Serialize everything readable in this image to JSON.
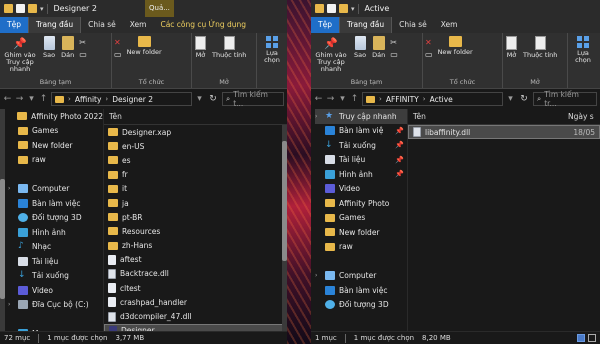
{
  "left": {
    "window_title": "Designer 2",
    "context_tab": "Quả...",
    "menu": {
      "file": "Tệp",
      "home": "Trang đầu",
      "share": "Chia sẻ",
      "view": "Xem",
      "context": "Các công cụ Ứng dụng"
    },
    "ribbon": {
      "pin": "Ghim vào Truy cập nhanh",
      "copy": "Sao",
      "paste": "Dán",
      "move": "New folder",
      "open": "Mở",
      "props": "Thuộc tính",
      "select": "Lựa chọn",
      "group_clipboard": "Bảng tạm",
      "group_organize": "Tổ chức",
      "group_open": "Mở"
    },
    "path": [
      "Affinity",
      "Designer 2"
    ],
    "search_placeholder": "Tìm kiếm t...",
    "nav_items": [
      {
        "label": "Affinity Photo 2022",
        "icon": "folder-icon"
      },
      {
        "label": "Games",
        "icon": "folder-icon"
      },
      {
        "label": "New folder",
        "icon": "folder-icon"
      },
      {
        "label": "raw",
        "icon": "folder-icon"
      },
      {
        "label": "",
        "icon": "spacer"
      },
      {
        "label": "Computer",
        "icon": "computer-icon"
      },
      {
        "label": "Bàn làm việc",
        "icon": "desktop-icon"
      },
      {
        "label": "Đối tượng 3D",
        "icon": "3d-objects-icon"
      },
      {
        "label": "Hình ảnh",
        "icon": "pictures-icon"
      },
      {
        "label": "Nhạc",
        "icon": "music-icon"
      },
      {
        "label": "Tài liệu",
        "icon": "documents-icon"
      },
      {
        "label": "Tải xuống",
        "icon": "downloads-icon"
      },
      {
        "label": "Video",
        "icon": "videos-icon"
      },
      {
        "label": "Đĩa Cục bộ (C:)",
        "icon": "drive-icon"
      },
      {
        "label": "",
        "icon": "spacer"
      },
      {
        "label": "Mạng",
        "icon": "network-icon"
      }
    ],
    "column_name": "Tên",
    "files": [
      {
        "name": "Designer.xap",
        "type": "folder"
      },
      {
        "name": "en-US",
        "type": "folder"
      },
      {
        "name": "es",
        "type": "folder"
      },
      {
        "name": "fr",
        "type": "folder"
      },
      {
        "name": "it",
        "type": "folder"
      },
      {
        "name": "ja",
        "type": "folder"
      },
      {
        "name": "pt-BR",
        "type": "folder"
      },
      {
        "name": "Resources",
        "type": "folder"
      },
      {
        "name": "zh-Hans",
        "type": "folder"
      },
      {
        "name": "aftest",
        "type": "file"
      },
      {
        "name": "Backtrace.dll",
        "type": "dll"
      },
      {
        "name": "cltest",
        "type": "file"
      },
      {
        "name": "crashpad_handler",
        "type": "file"
      },
      {
        "name": "d3dcompiler_47.dll",
        "type": "dll"
      },
      {
        "name": "Designer",
        "type": "exe",
        "selected": true
      }
    ],
    "status": {
      "count": "72 mục",
      "selected": "1 mục được chọn",
      "size": "3,77 MB"
    }
  },
  "right": {
    "window_title": "Active",
    "menu": {
      "file": "Tệp",
      "home": "Trang đầu",
      "share": "Chia sẻ",
      "view": "Xem"
    },
    "ribbon": {
      "pin": "Ghim vào Truy cập nhanh",
      "copy": "Sao",
      "paste": "Dán",
      "move": "New folder",
      "open": "Mở",
      "props": "Thuộc tính",
      "select": "Lựa chọn",
      "group_clipboard": "Bảng tạm",
      "group_organize": "Tổ chức",
      "group_open": "Mở"
    },
    "path": [
      "AFFINITY",
      "Active"
    ],
    "search_placeholder": "Tìm kiếm tr...",
    "nav_items": [
      {
        "label": "Truy cập nhanh",
        "icon": "quick-access-icon",
        "selected": true
      },
      {
        "label": "Bàn làm việ",
        "icon": "desktop-icon",
        "pinned": true
      },
      {
        "label": "Tải xuống",
        "icon": "downloads-icon",
        "pinned": true
      },
      {
        "label": "Tài liệu",
        "icon": "documents-icon",
        "pinned": true
      },
      {
        "label": "Hình ảnh",
        "icon": "pictures-icon",
        "pinned": true
      },
      {
        "label": "Video",
        "icon": "videos-icon"
      },
      {
        "label": "Affinity Photo",
        "icon": "folder-icon"
      },
      {
        "label": "Games",
        "icon": "folder-icon"
      },
      {
        "label": "New folder",
        "icon": "folder-icon"
      },
      {
        "label": "raw",
        "icon": "folder-icon"
      },
      {
        "label": "",
        "icon": "spacer"
      },
      {
        "label": "Computer",
        "icon": "computer-icon"
      },
      {
        "label": "Bàn làm việc",
        "icon": "desktop-icon"
      },
      {
        "label": "Đối tượng 3D",
        "icon": "3d-objects-icon"
      }
    ],
    "column_name": "Tên",
    "column_date": "Ngày s",
    "files": [
      {
        "name": "libaffinity.dll",
        "type": "dll",
        "date": "18/05",
        "selected": true
      }
    ],
    "status": {
      "count": "1 mục",
      "selected": "1 mục được chọn",
      "size": "8,20 MB"
    }
  }
}
